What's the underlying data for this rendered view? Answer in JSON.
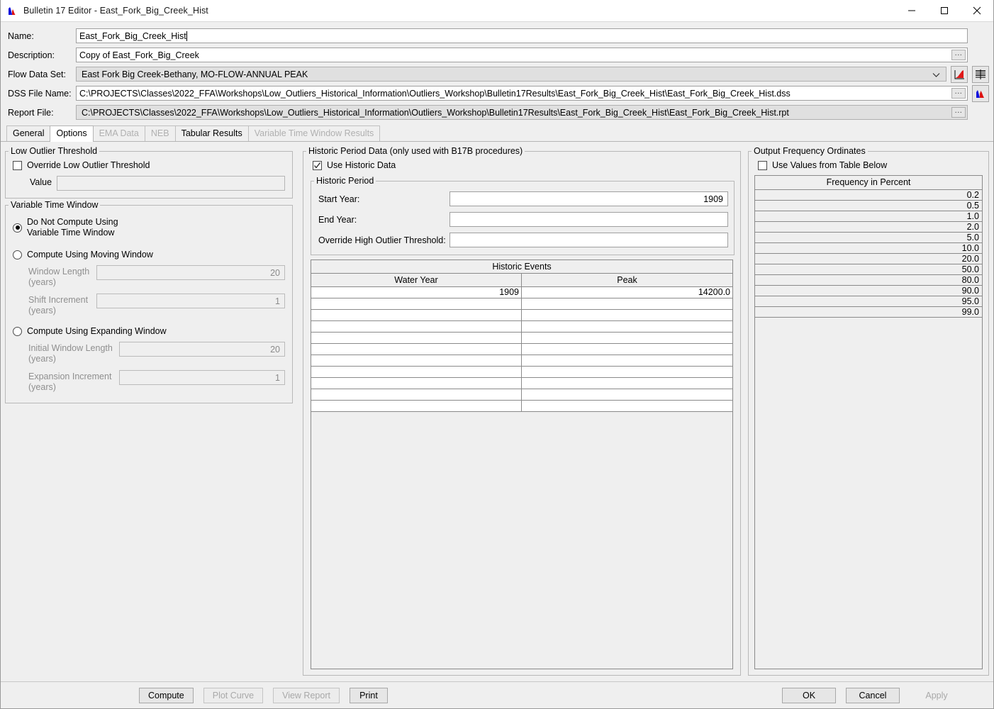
{
  "window": {
    "title": "Bulletin 17 Editor - East_Fork_Big_Creek_Hist",
    "app_icon": "histogram-icon",
    "minimize": "minimize-icon",
    "maximize": "maximize-icon",
    "close": "close-icon"
  },
  "fields": {
    "name_label": "Name:",
    "name_value": "East_Fork_Big_Creek_Hist",
    "description_label": "Description:",
    "description_value": "Copy of East_Fork_Big_Creek",
    "flow_data_set_label": "Flow Data Set:",
    "flow_data_set_value": "East Fork Big Creek-Bethany, MO-FLOW-ANNUAL PEAK",
    "dss_file_label": "DSS File Name:",
    "dss_file_value": "C:\\PROJECTS\\Classes\\2022_FFA\\Workshops\\Low_Outliers_Historical_Information\\Outliers_Workshop\\Bulletin17Results\\East_Fork_Big_Creek_Hist\\East_Fork_Big_Creek_Hist.dss",
    "report_file_label": "Report File:",
    "report_file_value": "C:\\PROJECTS\\Classes\\2022_FFA\\Workshops\\Low_Outliers_Historical_Information\\Outliers_Workshop\\Bulletin17Results\\East_Fork_Big_Creek_Hist\\East_Fork_Big_Creek_Hist.rpt",
    "browse_label": "..."
  },
  "tabs": [
    {
      "label": "General",
      "active": false,
      "disabled": false
    },
    {
      "label": "Options",
      "active": true,
      "disabled": false
    },
    {
      "label": "EMA Data",
      "active": false,
      "disabled": true
    },
    {
      "label": "NEB",
      "active": false,
      "disabled": true
    },
    {
      "label": "Tabular Results",
      "active": false,
      "disabled": false
    },
    {
      "label": "Variable Time Window Results",
      "active": false,
      "disabled": true
    }
  ],
  "low_outlier": {
    "group_title": "Low Outlier Threshold",
    "override_label": "Override Low Outlier Threshold",
    "override_checked": false,
    "value_label": "Value",
    "value": ""
  },
  "variable_time_window": {
    "group_title": "Variable Time Window",
    "options": [
      {
        "label": "Do Not Compute Using\nVariable Time Window",
        "selected": true
      },
      {
        "label": "Compute Using Moving Window",
        "selected": false
      },
      {
        "label": "Compute Using Expanding Window",
        "selected": false
      }
    ],
    "option1_line1": "Do Not Compute Using",
    "option1_line2": "Variable Time Window",
    "option2_label": "Compute Using Moving Window",
    "option3_label": "Compute Using Expanding Window",
    "window_length_label": "Window Length",
    "window_length_units": "(years)",
    "window_length_value": "20",
    "shift_increment_label": "Shift Increment",
    "shift_increment_units": "(years)",
    "shift_increment_value": "1",
    "initial_window_length_label": "Initial Window Length",
    "initial_window_length_units": "(years)",
    "initial_window_length_value": "20",
    "expansion_increment_label": "Expansion Increment",
    "expansion_increment_units": "(years)",
    "expansion_increment_value": "1"
  },
  "historic": {
    "group_title": "Historic Period Data (only used with B17B procedures)",
    "use_historic_label": "Use Historic Data",
    "use_historic_checked": true,
    "period_title": "Historic Period",
    "start_year_label": "Start Year:",
    "start_year_value": "1909",
    "end_year_label": "End Year:",
    "end_year_value": "",
    "override_high_label": "Override High Outlier Threshold:",
    "override_high_value": "",
    "events_title": "Historic Events",
    "events_columns": [
      "Water Year",
      "Peak"
    ],
    "events_rows": [
      [
        "1909",
        "14200.0"
      ],
      [
        "",
        ""
      ],
      [
        "",
        ""
      ],
      [
        "",
        ""
      ],
      [
        "",
        ""
      ],
      [
        "",
        ""
      ],
      [
        "",
        ""
      ],
      [
        "",
        ""
      ],
      [
        "",
        ""
      ],
      [
        "",
        ""
      ],
      [
        "",
        ""
      ]
    ]
  },
  "output_frequency": {
    "group_title": "Output Frequency Ordinates",
    "use_values_label": "Use Values from Table Below",
    "use_values_checked": false,
    "table_title": "Frequency in Percent",
    "values": [
      "0.2",
      "0.5",
      "1.0",
      "2.0",
      "5.0",
      "10.0",
      "20.0",
      "50.0",
      "80.0",
      "90.0",
      "95.0",
      "99.0"
    ]
  },
  "footer": {
    "compute": "Compute",
    "plot_curve": "Plot Curve",
    "view_report": "View Report",
    "print": "Print",
    "ok": "OK",
    "cancel": "Cancel",
    "apply": "Apply"
  },
  "colors": {
    "panel": "#efefef",
    "field": "#ffffff",
    "border": "#b8b8b8",
    "accent_red": "#dd1111",
    "accent_blue": "#1111dd",
    "disabled_text": "#8f8f8f"
  }
}
